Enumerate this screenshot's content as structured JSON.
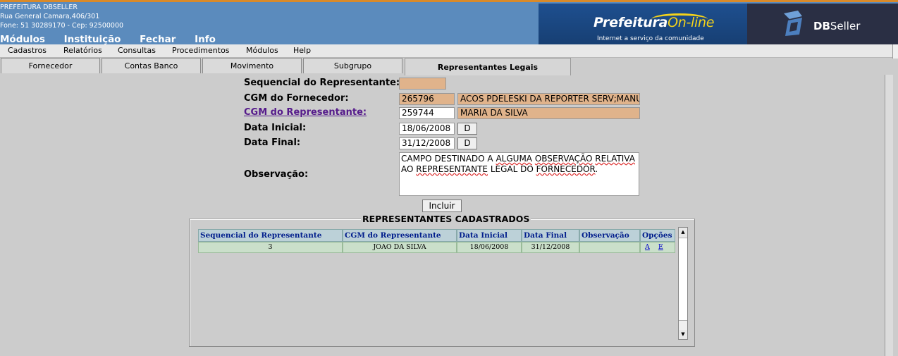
{
  "header": {
    "org_name": "PREFEITURA DBSELLER",
    "address": "Rua General Camara,406/301",
    "contact": "Fone: 51 30289170  -  Cep: 92500000",
    "top_menu": [
      "Módulos",
      "Instituição",
      "Fechar",
      "Info"
    ],
    "logo_prefeitura": "Prefeitura",
    "logo_online": "On-line",
    "logo_tagline": "Internet a serviço da comunidade",
    "logo_db": "DB",
    "logo_seller": "Seller"
  },
  "menubar": [
    "Cadastros",
    "Relatórios",
    "Consultas",
    "Procedimentos",
    "Módulos",
    "Help"
  ],
  "tabs": [
    "Fornecedor",
    "Contas Banco",
    "Movimento",
    "Subgrupo",
    "Representantes Legais"
  ],
  "active_tab": "Representantes Legais",
  "form": {
    "seq_label": "Sequencial do Representante:",
    "seq_value": "",
    "cgm_forn_label": "CGM do Fornecedor:",
    "cgm_forn_code": "265796",
    "cgm_forn_name": "ACOS PDELESKI DA REPORTER SERV;MANU",
    "cgm_rep_label": "CGM do Representante:",
    "cgm_rep_code": "259744",
    "cgm_rep_name": "MARIA DA SILVA",
    "data_ini_label": "Data Inicial:",
    "data_ini_value": "18/06/2008",
    "data_fim_label": "Data Final:",
    "data_fim_value": "31/12/2008",
    "date_button": "D",
    "obs_label": "Observação:",
    "obs_line1_a": "CAMPO DESTINADO A ",
    "obs_line1_b": "ALGUMA",
    "obs_line1_c": " ",
    "obs_line1_d": "OBSERVAÇÃO",
    "obs_line1_e": " ",
    "obs_line1_f": "RELATIVA",
    "obs_line2_a": "AO ",
    "obs_line2_b": "REPRESENTANTE",
    "obs_line2_c": " LEGAL DO ",
    "obs_line2_d": "FORNECEDOR",
    "obs_line2_e": ".",
    "submit_label": "Incluir"
  },
  "list": {
    "title": "REPRESENTANTES CADASTRADOS",
    "columns": [
      "Sequencial do Representante",
      "CGM do Representante",
      "Data Inicial",
      "Data Final",
      "Observação",
      "Opções"
    ],
    "rows": [
      {
        "seq": "3",
        "cgm": "JOAO DA SILVA",
        "data_ini": "18/06/2008",
        "data_fim": "31/12/2008",
        "obs": "",
        "opt_a": "A",
        "opt_e": "E"
      }
    ]
  },
  "icons": {
    "scroll_up": "triangle-up-icon",
    "scroll_down": "triangle-down-icon"
  },
  "colors": {
    "header_bg": "#5b8bbd",
    "readonly_field": "#e0b38b",
    "grid_header": "#bcd1d8",
    "grid_row": "#cadfca",
    "link": "#551a8b"
  }
}
